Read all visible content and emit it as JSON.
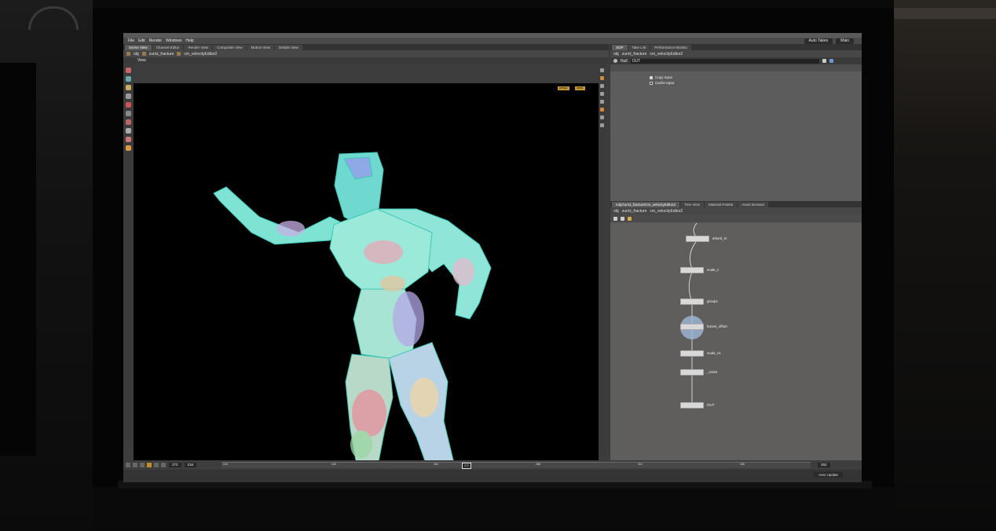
{
  "menu": {
    "file": "File",
    "edit": "Edit",
    "render": "Render",
    "windows": "Windows",
    "help": "Help",
    "takes": "Auto Takes",
    "main": "Main"
  },
  "left_tabs": [
    "Scene View",
    "Channel Editor",
    "Render View",
    "Composite View",
    "Motion View",
    "Details View"
  ],
  "left_path": {
    "obj": "obj",
    "a": "zurict_fracture",
    "b": "cm_velocityEditor2"
  },
  "view_label": "View",
  "status_path": "/out/cm_ver_cut/cut(StepRendFlags",
  "status_num": "0.0000",
  "viewport_badges": [
    "persp1",
    "cam1"
  ],
  "right_tabs": [
    "SOP",
    "Take List",
    "Performance Monitor"
  ],
  "right_path": {
    "obj": "obj",
    "a": "zurict_fracture",
    "b": "cm_velocityEditor2"
  },
  "node_title": {
    "type": "Null",
    "name": "OUT"
  },
  "params": [
    {
      "label": "Copy Input",
      "checked": true
    },
    {
      "label": "Cache Input",
      "checked": false
    }
  ],
  "net_tabs": [
    "/obj/zurict_fracture/cm_velocityEditor2",
    "Tree View",
    "Material Palette",
    "Asset Browser"
  ],
  "net_path": {
    "obj": "obj",
    "a": "zurict_fracture",
    "b": "cm_velocityEditor2"
  },
  "nodes": [
    {
      "name": "inherit_N",
      "selected": false
    },
    {
      "name": "scale_v",
      "selected": false
    },
    {
      "name": "group1",
      "selected": false
    },
    {
      "name": "bones_offset",
      "selected": true
    },
    {
      "name": "scale_v1",
      "selected": false
    },
    {
      "name": "_noise",
      "selected": false
    },
    {
      "name": "OUT",
      "selected": false
    }
  ],
  "timeline": {
    "frame_a": "272",
    "frame_b": "216",
    "marker": "272",
    "end": "252",
    "ticks": [
      "216",
      "240",
      "264",
      "288",
      "312",
      "336"
    ]
  },
  "auto_update": "Auto Update",
  "icons": [
    "home-icon",
    "play-icon",
    "prev-frame-icon",
    "next-frame-icon",
    "gear-icon",
    "help-icon",
    "pin-icon"
  ]
}
